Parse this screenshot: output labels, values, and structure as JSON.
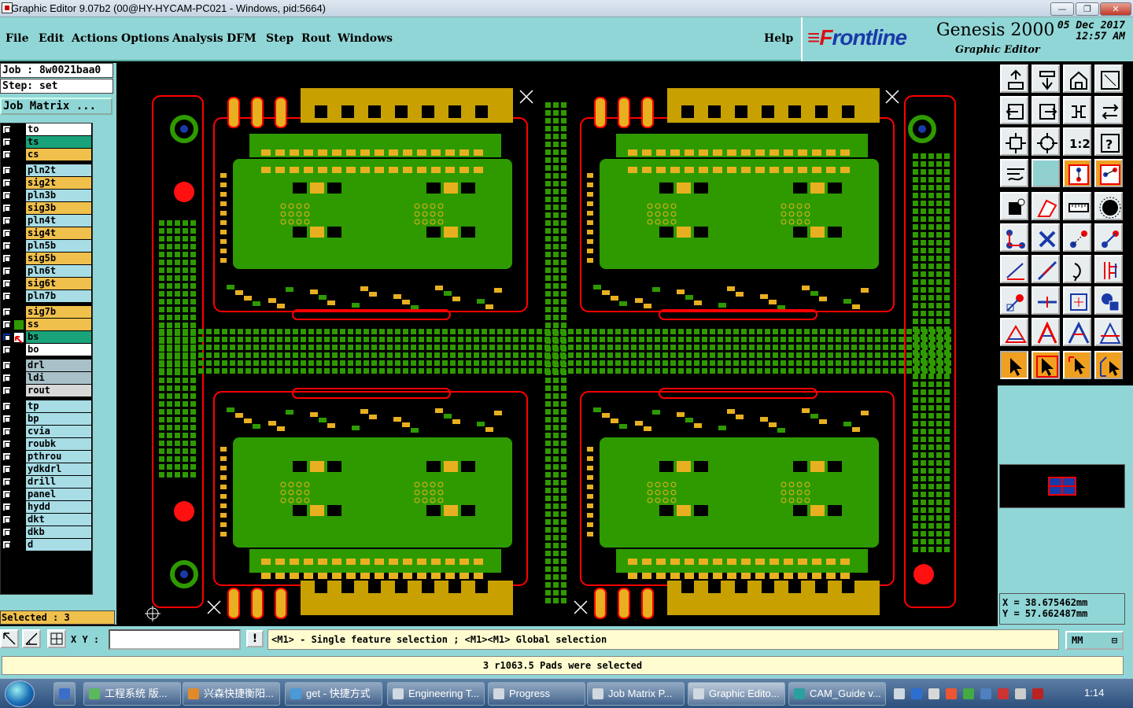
{
  "window": {
    "title": "Graphic Editor 9.07b2 (00@HY-HYCAM-PC021 - Windows, pid:5664)",
    "min": "—",
    "max": "❐",
    "close": "✕"
  },
  "menu": [
    "File",
    "Edit",
    "Actions",
    "Options",
    "Analysis",
    "DFM",
    "Step",
    "Rout",
    "Windows"
  ],
  "help": "Help",
  "brand": {
    "logo_a": "≡F",
    "logo_b": "rontline",
    "product": "Genesis 2000",
    "subtitle": "Graphic Editor",
    "date": "05 Dec 2017",
    "time": "12:57 AM"
  },
  "job": {
    "job_line": "Job : 8w0021baa0",
    "step_line": "Step: set",
    "matrix_button": "Job Matrix ..."
  },
  "layers": [
    {
      "name": "to",
      "color": "#ffffff"
    },
    {
      "name": "ts",
      "color": "#1aa37a"
    },
    {
      "name": "cs",
      "color": "#f0c04c"
    },
    {
      "name": "pln2t",
      "color": "#a8dde6"
    },
    {
      "name": "sig2t",
      "color": "#f0c04c"
    },
    {
      "name": "pln3b",
      "color": "#a8dde6"
    },
    {
      "name": "sig3b",
      "color": "#f0c04c"
    },
    {
      "name": "pln4t",
      "color": "#a8dde6"
    },
    {
      "name": "sig4t",
      "color": "#f0c04c"
    },
    {
      "name": "pln5b",
      "color": "#a8dde6"
    },
    {
      "name": "sig5b",
      "color": "#f0c04c"
    },
    {
      "name": "pln6t",
      "color": "#a8dde6"
    },
    {
      "name": "sig6t",
      "color": "#f0c04c"
    },
    {
      "name": "pln7b",
      "color": "#a8dde6"
    },
    {
      "name": "sig7b",
      "color": "#f0c04c"
    },
    {
      "name": "ss",
      "color": "#f0c04c"
    },
    {
      "name": "bs",
      "color": "#1aa37a"
    },
    {
      "name": "bo",
      "color": "#ffffff"
    },
    {
      "name": "drl",
      "color": "#a8c0c8"
    },
    {
      "name": "ldi",
      "color": "#a8c0c8"
    },
    {
      "name": "rout",
      "color": "#d8d8d8"
    },
    {
      "name": "tp",
      "color": "#a8dde6"
    },
    {
      "name": "bp",
      "color": "#a8dde6"
    },
    {
      "name": "cvia",
      "color": "#a8dde6"
    },
    {
      "name": "roubk",
      "color": "#a8dde6"
    },
    {
      "name": "pthrou",
      "color": "#a8dde6"
    },
    {
      "name": "ydkdrl",
      "color": "#a8dde6"
    },
    {
      "name": "drill",
      "color": "#a8dde6"
    },
    {
      "name": "panel",
      "color": "#a8dde6"
    },
    {
      "name": "hydd",
      "color": "#a8dde6"
    },
    {
      "name": "dkt",
      "color": "#a8dde6"
    },
    {
      "name": "dkb",
      "color": "#a8dde6"
    },
    {
      "name": "d",
      "color": "#a8dde6"
    }
  ],
  "selected": "Selected : 3",
  "coords": {
    "x": "X = 38.675462mm",
    "y": "Y = 57.662487mm"
  },
  "status": {
    "xy_label": "X Y :",
    "xy_value": "",
    "excl": "!",
    "prompt": "<M1> - Single feature selection ; <M1><M1> Global selection",
    "units": "MM"
  },
  "message": "3 r1063.5 Pads were selected",
  "taskbar": [
    {
      "label": "工程系统  版...",
      "color": "#5cb85c"
    },
    {
      "label": "兴森快捷衡阳...",
      "color": "#e08a2c"
    },
    {
      "label": "get - 快捷方式",
      "color": "#4a9ad8"
    },
    {
      "label": "Engineering T...",
      "color": "#d0d8e0"
    },
    {
      "label": "Progress",
      "color": "#d0d8e0"
    },
    {
      "label": "Job Matrix P...",
      "color": "#d0d8e0"
    },
    {
      "label": "Graphic Edito...",
      "color": "#d0d8e0"
    },
    {
      "label": "CAM_Guide v...",
      "color": "#2aa0a0"
    }
  ],
  "clock": "1:14",
  "colors": {
    "board_green": "#2e9a00",
    "copper": "#c8a000",
    "outline": "#ff0000",
    "pad": "#e8b020",
    "background": "#000000",
    "panel": "#91d6d6"
  }
}
